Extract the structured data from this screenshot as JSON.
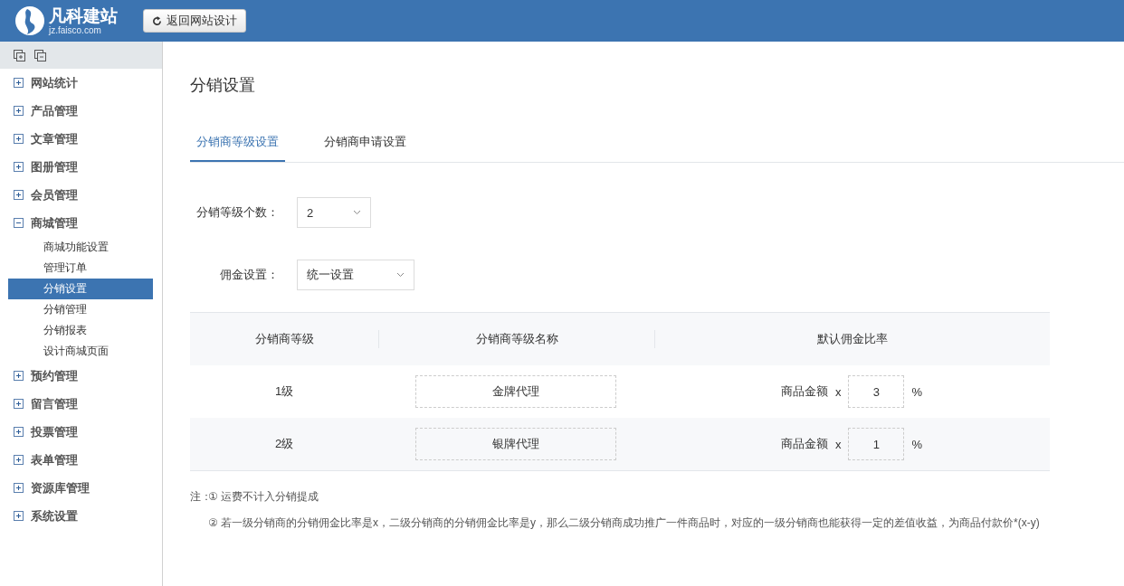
{
  "header": {
    "logo_name": "凡科建站",
    "logo_url": "jz.faisco.com",
    "back_button": "返回网站设计"
  },
  "sidebar": {
    "items": [
      {
        "label": "网站统计",
        "expanded": false
      },
      {
        "label": "产品管理",
        "expanded": false
      },
      {
        "label": "文章管理",
        "expanded": false
      },
      {
        "label": "图册管理",
        "expanded": false
      },
      {
        "label": "会员管理",
        "expanded": false
      },
      {
        "label": "商城管理",
        "expanded": true,
        "children": [
          {
            "label": "商城功能设置",
            "selected": false
          },
          {
            "label": "管理订单",
            "selected": false
          },
          {
            "label": "分销设置",
            "selected": true
          },
          {
            "label": "分销管理",
            "selected": false
          },
          {
            "label": "分销报表",
            "selected": false
          },
          {
            "label": "设计商城页面",
            "selected": false
          }
        ]
      },
      {
        "label": "预约管理",
        "expanded": false
      },
      {
        "label": "留言管理",
        "expanded": false
      },
      {
        "label": "投票管理",
        "expanded": false
      },
      {
        "label": "表单管理",
        "expanded": false
      },
      {
        "label": "资源库管理",
        "expanded": false
      },
      {
        "label": "系统设置",
        "expanded": false
      }
    ]
  },
  "page_title": "分销设置",
  "tabs": [
    {
      "label": "分销商等级设置",
      "selected": true
    },
    {
      "label": "分销商申请设置",
      "selected": false
    }
  ],
  "form": [
    {
      "label": "分销等级个数：",
      "value": "2"
    },
    {
      "label": "佣金设置：",
      "value": "统一设置"
    }
  ],
  "table": {
    "columns": [
      "分销商等级",
      "分销商等级名称",
      "默认佣金比率"
    ],
    "rows": [
      {
        "level": "1级",
        "name": "金牌代理",
        "prefix": "商品金额",
        "times": "x",
        "rate": "3",
        "unit": "%"
      },
      {
        "level": "2级",
        "name": "银牌代理",
        "prefix": "商品金额",
        "times": "x",
        "rate": "1",
        "unit": "%"
      }
    ]
  },
  "notes": {
    "label": "注：",
    "items": [
      "① 运费不计入分销提成",
      "② 若一级分销商的分销佣金比率是x，二级分销商的分销佣金比率是y，那么二级分销商成功推广一件商品时，对应的一级分销商也能获得一定的差值收益，为商品付款价*(x-y)"
    ]
  }
}
